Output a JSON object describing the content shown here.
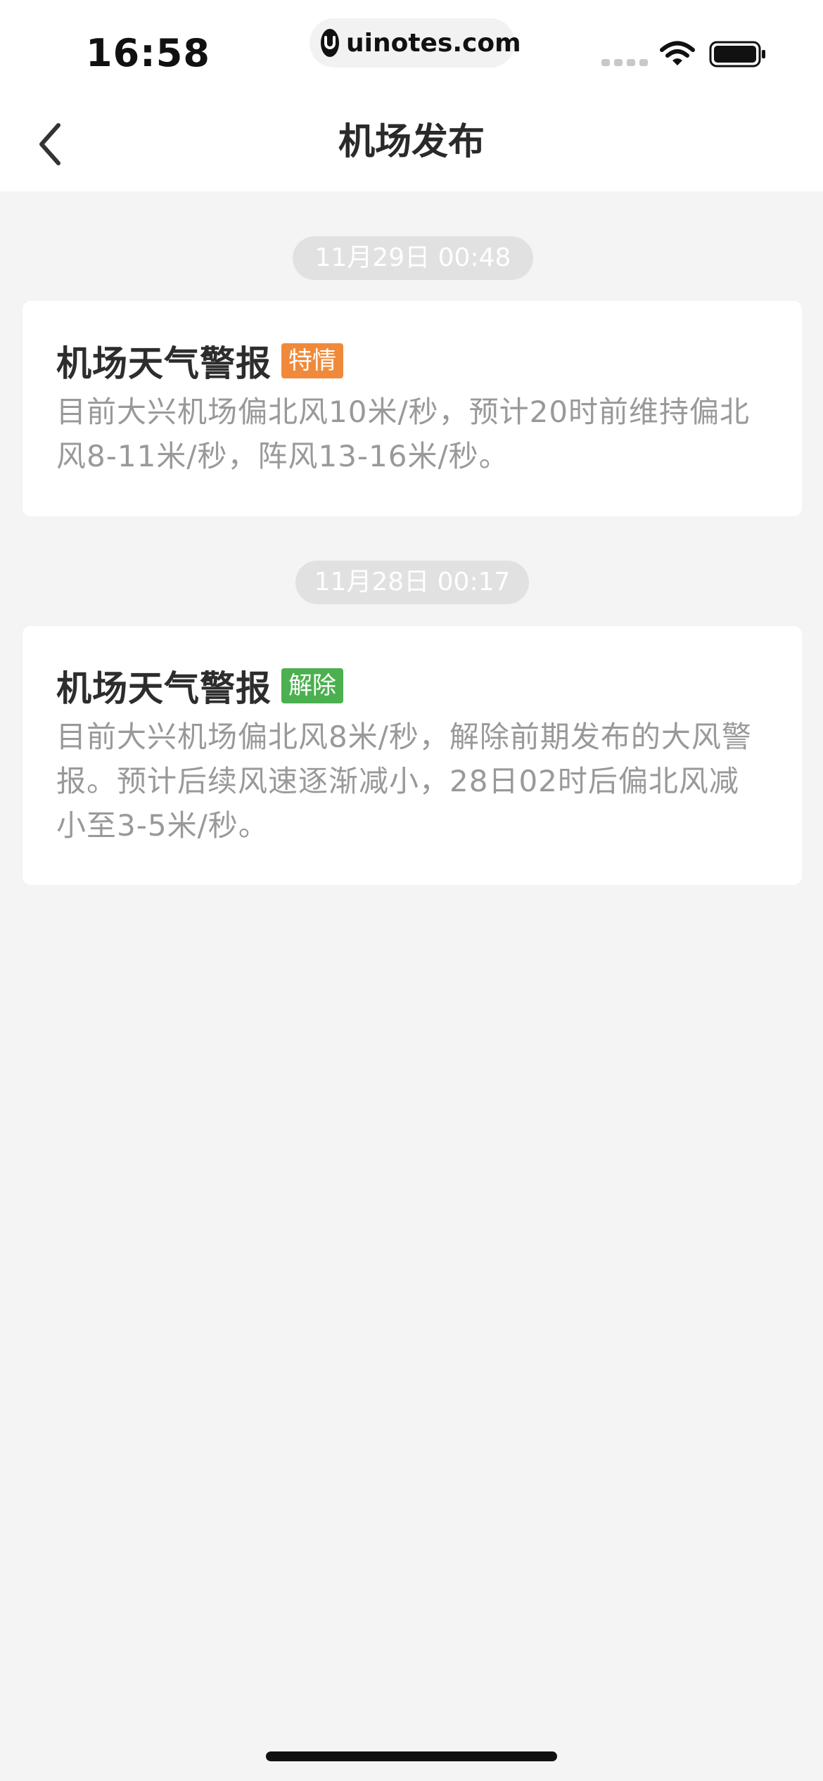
{
  "status_bar": {
    "time": "16:58",
    "watermark": "uinotes.com"
  },
  "nav": {
    "title": "机场发布"
  },
  "feed": [
    {
      "date": "11月29日 00:48",
      "title": "机场天气警报",
      "badge": "特情",
      "badge_color": "#f08a3a",
      "body": "目前大兴机场偏北风10米/秒，预计20时前维持偏北风8-11米/秒，阵风13-16米/秒。"
    },
    {
      "date": "11月28日 00:17",
      "title": "机场天气警报",
      "badge": "解除",
      "badge_color": "#4caf50",
      "body": "目前大兴机场偏北风8米/秒，解除前期发布的大风警报。预计后续风速逐渐减小，28日02时后偏北风减小至3-5米/秒。"
    }
  ],
  "colors": {
    "background": "#f4f4f4",
    "card": "#ffffff",
    "date_pill": "#e1e1e1",
    "body_text": "#999999"
  },
  "icons": {
    "back": "chevron-left-icon",
    "wifi": "wifi-icon",
    "battery": "battery-icon",
    "watermark_logo": "uinotes-logo-icon"
  }
}
